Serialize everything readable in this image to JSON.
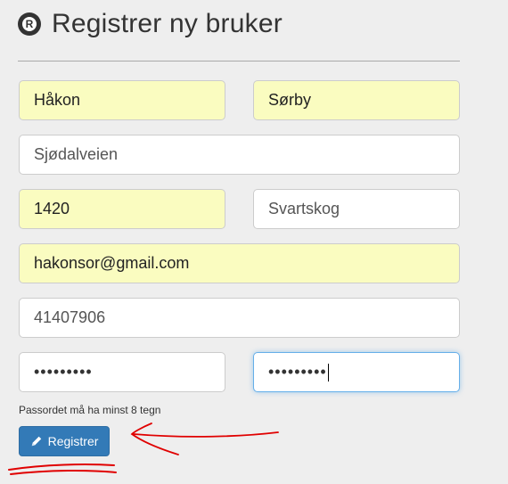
{
  "header": {
    "title": "Registrer ny bruker",
    "logo_letter": "R",
    "logo_icon": "registered-icon"
  },
  "form": {
    "first_name": "Håkon",
    "last_name": "Sørby",
    "address": "Sjødalveien",
    "postal_code": "1420",
    "city": "Svartskog",
    "email": "hakonsor@gmail.com",
    "phone": "41407906",
    "password": "•••••••••",
    "password_confirm": "•••••••••",
    "password_hint": "Passordet må ha minst 8 tegn",
    "submit_label": "Registrer",
    "submit_icon": "pencil-icon"
  },
  "colors": {
    "autofill": "#fafcc0",
    "primary": "#337ab7",
    "annotation": "#e00000"
  }
}
